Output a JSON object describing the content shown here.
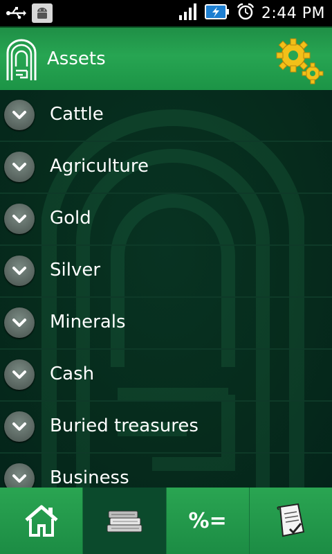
{
  "status_bar": {
    "time": "2:44 PM",
    "icons": [
      "usb-icon",
      "android-debug-icon",
      "signal-icon",
      "battery-icon",
      "alarm-icon"
    ]
  },
  "header": {
    "title": "Assets",
    "icons": [
      "app-logo",
      "settings-gears-icon"
    ]
  },
  "assets": {
    "items": [
      {
        "label": "Cattle"
      },
      {
        "label": "Agriculture"
      },
      {
        "label": "Gold"
      },
      {
        "label": "Silver"
      },
      {
        "label": "Minerals"
      },
      {
        "label": "Cash"
      },
      {
        "label": "Buried treasures"
      },
      {
        "label": "Business"
      }
    ]
  },
  "tabbar": {
    "active_tab": "books",
    "percent_label": "%=",
    "tabs": [
      "home-icon",
      "books-icon",
      "percent-equals-icon",
      "report-icon"
    ]
  },
  "colors": {
    "header_green": "#27a552",
    "list_background": "#062b1c",
    "active_tab": "#0b4a2c",
    "text": "#ffffff"
  }
}
